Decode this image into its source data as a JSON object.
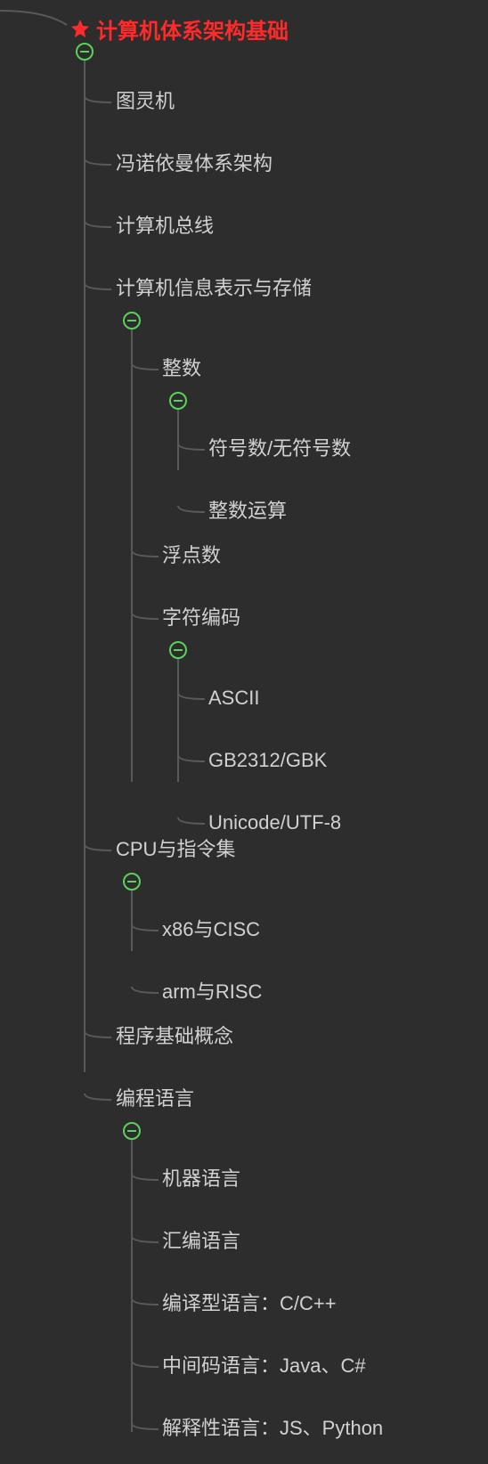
{
  "colors": {
    "background": "#2d2d2d",
    "text": "#d1d1d1",
    "root": "#ff2a2a",
    "connector": "#58595b",
    "toggleBorder": "#5ad15a"
  },
  "tree": {
    "label": "计算机体系架构基础",
    "starred": true,
    "expanded": true,
    "children": [
      {
        "label": "图灵机"
      },
      {
        "label": "冯诺依曼体系架构"
      },
      {
        "label": "计算机总线"
      },
      {
        "label": "计算机信息表示与存储",
        "expanded": true,
        "children": [
          {
            "label": "整数",
            "expanded": true,
            "children": [
              {
                "label": "符号数/无符号数"
              },
              {
                "label": "整数运算"
              }
            ]
          },
          {
            "label": "浮点数"
          },
          {
            "label": "字符编码",
            "expanded": true,
            "children": [
              {
                "label": "ASCII"
              },
              {
                "label": "GB2312/GBK"
              },
              {
                "label": "Unicode/UTF-8"
              }
            ]
          }
        ]
      },
      {
        "label": "CPU与指令集",
        "expanded": true,
        "children": [
          {
            "label": "x86与CISC"
          },
          {
            "label": "arm与RISC"
          }
        ]
      },
      {
        "label": "程序基础概念"
      },
      {
        "label": "编程语言",
        "expanded": true,
        "children": [
          {
            "label": "机器语言"
          },
          {
            "label": "汇编语言"
          },
          {
            "label": "编译型语言：C/C++"
          },
          {
            "label": "中间码语言：Java、C#"
          },
          {
            "label": "解释性语言：JS、Python"
          }
        ]
      }
    ]
  }
}
